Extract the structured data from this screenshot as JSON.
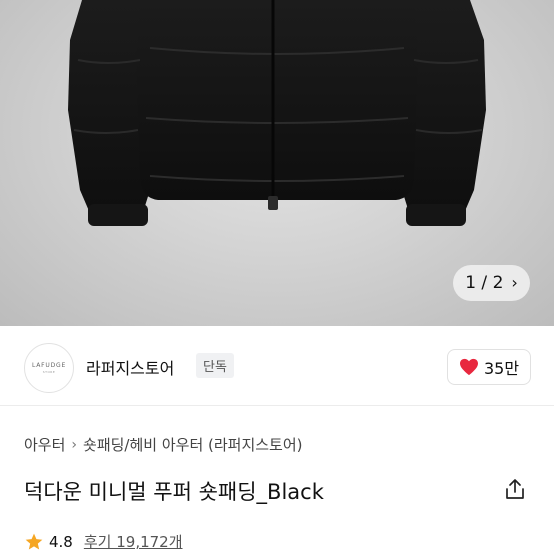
{
  "product_image": {
    "description_icon": "black-puffer-jacket-photo",
    "pager": {
      "current": "1",
      "separator": "/",
      "total": "2",
      "next_icon": "chevron-right-icon"
    }
  },
  "store": {
    "logo_text": "LAFUDGE",
    "logo_subtext": "STORE",
    "name": "라퍼지스토어",
    "badge": "단독",
    "like_icon": "heart-icon",
    "like_color": "#e8283f",
    "like_count": "35만"
  },
  "breadcrumb": {
    "items": [
      "아우터",
      "숏패딩/헤비 아우터 (라퍼지스토어)"
    ],
    "separator_icon": "chevron-right-icon"
  },
  "product": {
    "title": "덕다운 미니멀 푸퍼 숏패딩_Black",
    "share_icon": "share-icon"
  },
  "rating": {
    "star_icon": "star-icon",
    "star_color": "#f5a623",
    "score": "4.8",
    "reviews_label": "후기 19,172개"
  }
}
